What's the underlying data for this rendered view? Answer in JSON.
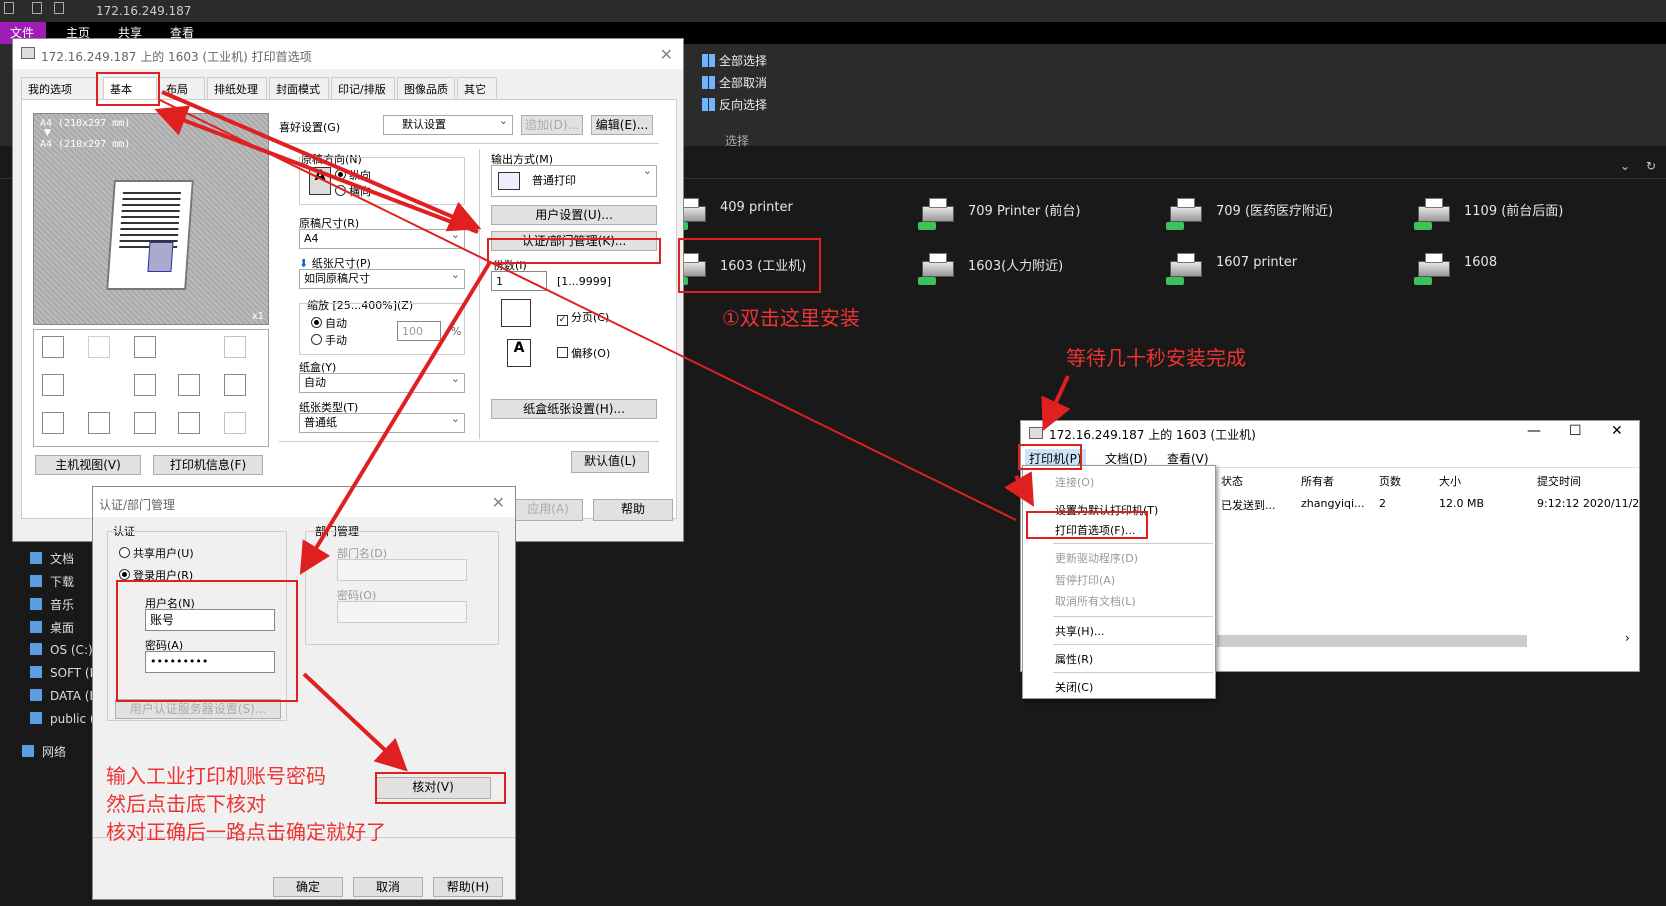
{
  "explorer": {
    "title": "172.16.249.187",
    "tabs": {
      "file": "文件",
      "home": "主页",
      "share": "共享",
      "view": "查看"
    },
    "ribbon": {
      "select_all": "全部选择",
      "select_none": "全部取消",
      "invert": "反向选择",
      "group": "选择"
    },
    "printers": [
      {
        "name": "409 printer"
      },
      {
        "name": "709 Printer (前台)"
      },
      {
        "name": "709 (医药医疗附近)"
      },
      {
        "name": "1109 (前台后面)"
      },
      {
        "name": "1603 (工业机)"
      },
      {
        "name": "1603(人力附近)"
      },
      {
        "name": "1607 printer"
      },
      {
        "name": "1608"
      }
    ],
    "nav": [
      "文档",
      "下载",
      "音乐",
      "桌面",
      "OS (C:)",
      "SOFT (D",
      "DATA (E",
      "public (",
      "网络"
    ]
  },
  "prefs": {
    "title": "172.16.249.187 上的 1603 (工业机) 打印首选项",
    "tabs": [
      "我的选项",
      "基本",
      "布局",
      "排纸处理",
      "封面模式",
      "印记/排版",
      "图像品质",
      "其它"
    ],
    "preview_line1": "A4 (210x297 mm)",
    "preview_line2": "A4 (210x297 mm)",
    "preview_count": "x1",
    "fav_label": "喜好设置(G)",
    "fav_value": "默认设置",
    "add_btn": "追加(D)...",
    "edit_btn": "编辑(E)...",
    "orientation_label": "原稿方向(N)",
    "portrait": "纵向",
    "landscape": "横向",
    "orig_size_label": "原稿尺寸(R)",
    "orig_size_value": "A4",
    "paper_size_label": "纸张尺寸(P)",
    "paper_size_value": "如同原稿尺寸",
    "zoom_label": "缩放 [25...400%](Z)",
    "zoom_auto": "自动",
    "zoom_manual": "手动",
    "zoom_value": "100",
    "zoom_unit": "%",
    "tray_label": "纸盒(Y)",
    "tray_value": "自动",
    "paper_type_label": "纸张类型(T)",
    "paper_type_value": "普通纸",
    "output_label": "输出方式(M)",
    "output_value": "普通打印",
    "user_settings_btn": "用户设置(U)...",
    "auth_btn": "认证/部门管理(K)...",
    "copies_label": "份数(I)",
    "copies_value": "1",
    "copies_range": "[1...9999]",
    "collate": "分页(C)",
    "offset": "偏移(O)",
    "tray_paper_btn": "纸盒纸张设置(H)...",
    "default_btn": "默认值(L)",
    "printer_view_btn": "主机视图(V)",
    "printer_info_btn": "打印机信息(F)",
    "apply_btn": "应用(A)",
    "help_btn": "帮助"
  },
  "auth": {
    "title": "认证/部门管理",
    "auth_group": "认证",
    "public_user": "共享用户(U)",
    "registered_user": "登录用户(R)",
    "username_label": "用户名(N)",
    "username_value": "账号",
    "password_label": "密码(A)",
    "password_value": "•••••••••",
    "server_btn": "用户认证服务器设置(S)...",
    "dept_group": "部门管理",
    "dept_name_label": "部门名(D)",
    "dept_pw_label": "密码(O)",
    "verify_btn": "核对(V)",
    "ok_btn": "确定",
    "cancel_btn": "取消",
    "help_btn": "帮助(H)"
  },
  "queue": {
    "title": "172.16.249.187 上的 1603 (工业机)",
    "menus": [
      "打印机(P)",
      "文档(D)",
      "查看(V)"
    ],
    "columns": [
      "状态",
      "所有者",
      "页数",
      "大小",
      "提交时间"
    ],
    "row": {
      "status": "已发送到...",
      "owner": "zhangyiqi...",
      "pages": "2",
      "size": "12.0 MB",
      "time": "9:12:12  2020/11/2"
    },
    "menu_items": [
      "连接(O)",
      "设置为默认打印机(T)",
      "打印首选项(F)...",
      "更新驱动程序(D)",
      "暂停打印(A)",
      "取消所有文档(L)",
      "共享(H)...",
      "属性(R)",
      "关闭(C)"
    ]
  },
  "annotations": {
    "step1": "①双击这里安装",
    "wait": "等待几十秒安装完成",
    "instruction_1": "输入工业打印机账号密码",
    "instruction_2": "然后点击底下核对",
    "instruction_3": "核对正确后一路点击确定就好了"
  },
  "colors": {
    "annotation": "#e02020",
    "file_tab": "#9f1cb7",
    "background": "#191919"
  }
}
